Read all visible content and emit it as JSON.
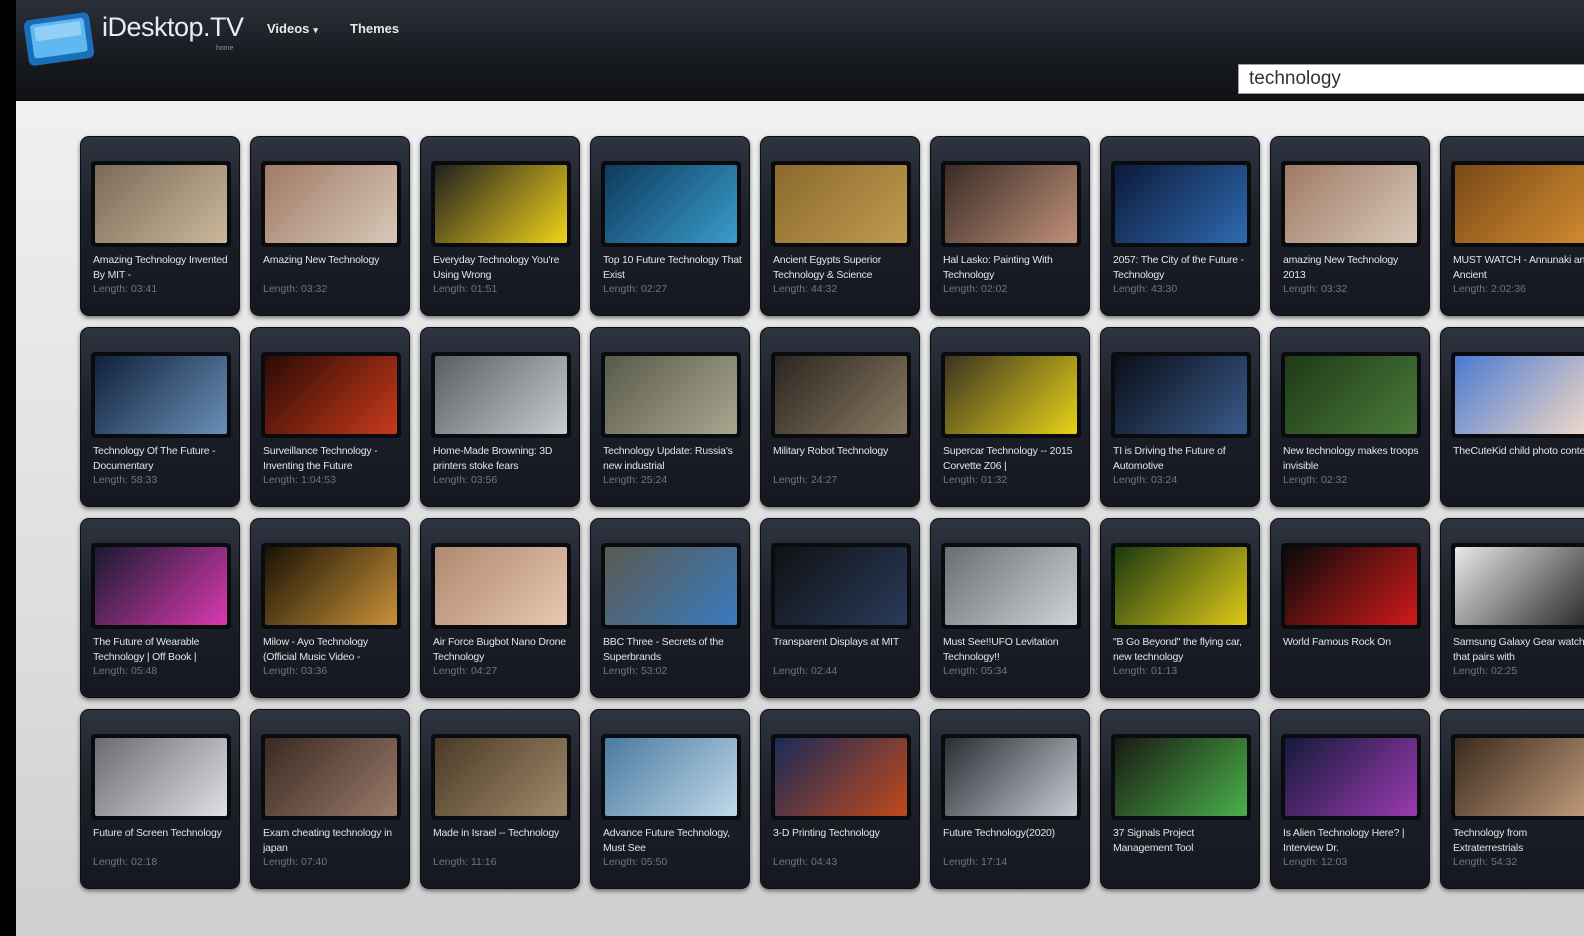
{
  "app": {
    "logo_text": "iDesktop.TV",
    "logo_subtext": "home",
    "nav": {
      "videos_label": "Videos",
      "themes_label": "Themes"
    },
    "search": {
      "value": "technology"
    }
  },
  "colors": {
    "topbar": "#181b21",
    "card": "#1b1f27",
    "accent": "#3aa0e8"
  },
  "videos": [
    {
      "title": "Amazing Technology Invented By MIT -",
      "length": "Length: 03:41",
      "thumb": [
        "#7a6a58",
        "#cbb89a"
      ]
    },
    {
      "title": "Amazing New Technology",
      "length": "Length: 03:32",
      "thumb": [
        "#a07a66",
        "#d8c8b8"
      ]
    },
    {
      "title": "Everyday Technology You're Using Wrong",
      "length": "Length: 01:51",
      "thumb": [
        "#202020",
        "#f2d21a"
      ]
    },
    {
      "title": "Top 10 Future Technology That Exist",
      "length": "Length: 02:27",
      "thumb": [
        "#0e3a5c",
        "#3a9ccc"
      ]
    },
    {
      "title": "Ancient Egypts Superior Technology & Science",
      "length": "Length: 44:32",
      "thumb": [
        "#8a6a2c",
        "#c09a50"
      ]
    },
    {
      "title": "Hal Lasko: Painting With Technology",
      "length": "Length: 02:02",
      "thumb": [
        "#3a2c26",
        "#c0907a"
      ]
    },
    {
      "title": "2057: The City of the Future - Technology",
      "length": "Length: 43:30",
      "thumb": [
        "#0c1a3a",
        "#2e6ab0"
      ]
    },
    {
      "title": "amazing New Technology 2013",
      "length": "Length: 03:32",
      "thumb": [
        "#a07a66",
        "#d8c8b8"
      ]
    },
    {
      "title": "MUST WATCH - Annunaki and Ancient",
      "length": "Length: 2:02:36",
      "thumb": [
        "#7a4a18",
        "#d08a30"
      ]
    },
    {
      "title": "Technology Of The Future - Documentary",
      "length": "Length: 58:33",
      "thumb": [
        "#10203a",
        "#6a90b8"
      ]
    },
    {
      "title": "Surveillance Technology - Inventing the Future",
      "length": "Length: 1:04:53",
      "thumb": [
        "#2a0a06",
        "#c83a1a"
      ]
    },
    {
      "title": "Home-Made Browning: 3D printers stoke fears",
      "length": "Length: 03:56",
      "thumb": [
        "#5a5e62",
        "#c8ccd0"
      ]
    },
    {
      "title": "Technology Update: Russia's new industrial",
      "length": "Length: 25:24",
      "thumb": [
        "#5a5a4a",
        "#a8a890"
      ]
    },
    {
      "title": "Military Robot Technology",
      "length": "Length: 24:27",
      "thumb": [
        "#2a2620",
        "#8a7a62"
      ]
    },
    {
      "title": "Supercar Technology -- 2015 Corvette Z06 |",
      "length": "Length: 01:32",
      "thumb": [
        "#3a3420",
        "#e8d218"
      ]
    },
    {
      "title": "TI is Driving the Future of Automotive",
      "length": "Length: 03:24",
      "thumb": [
        "#0a0e18",
        "#3a5a8a"
      ]
    },
    {
      "title": "New technology makes troops invisible",
      "length": "Length: 02:32",
      "thumb": [
        "#1e3a16",
        "#4a7a3a"
      ]
    },
    {
      "title": "TheCuteKid child photo contest",
      "length": "",
      "thumb": [
        "#4a7ad0",
        "#f0d8c8"
      ]
    },
    {
      "title": "The Future of Wearable Technology | Off Book |",
      "length": "Length: 05:48",
      "thumb": [
        "#1a1a30",
        "#d83ab0"
      ]
    },
    {
      "title": "Milow - Ayo Technology (Official Music Video -",
      "length": "Length: 03:36",
      "thumb": [
        "#1a1206",
        "#c89038"
      ]
    },
    {
      "title": "Air Force Bugbot Nano Drone Technology",
      "length": "Length: 04:27",
      "thumb": [
        "#b08870",
        "#e8c8b0"
      ]
    },
    {
      "title": "BBC Three - Secrets of the Superbrands",
      "length": "Length: 53:02",
      "thumb": [
        "#5a5a50",
        "#3a7ac0"
      ]
    },
    {
      "title": "Transparent Displays at MIT",
      "length": "Length: 02:44",
      "thumb": [
        "#101214",
        "#2a3a5a"
      ]
    },
    {
      "title": "Must See!!UFO Levitation Technology!!",
      "length": "Length: 05:34",
      "thumb": [
        "#6a6e72",
        "#d0d4d8"
      ]
    },
    {
      "title": "\"B Go Beyond\" the flying car, new technology",
      "length": "Length: 01:13",
      "thumb": [
        "#1a3a10",
        "#e0c818"
      ]
    },
    {
      "title": "World Famous Rock On",
      "length": "",
      "thumb": [
        "#0a0a0a",
        "#d01a1a"
      ]
    },
    {
      "title": "Samsung Galaxy Gear watch that pairs with",
      "length": "Length: 02:25",
      "thumb": [
        "#e8e8e8",
        "#2a2a2a"
      ]
    },
    {
      "title": "Future of Screen Technology",
      "length": "Length: 02:18",
      "thumb": [
        "#6a6a70",
        "#e0e0e4"
      ]
    },
    {
      "title": "Exam cheating technology in japan",
      "length": "Length: 07:40",
      "thumb": [
        "#3a2a22",
        "#9a7a6a"
      ]
    },
    {
      "title": "Made in Israel -- Technology",
      "length": "Length: 11:16",
      "thumb": [
        "#4a3a26",
        "#a08a6a"
      ]
    },
    {
      "title": "Advance Future Technology, Must See",
      "length": "Length: 05:50",
      "thumb": [
        "#4a7aa0",
        "#c0d8ea"
      ]
    },
    {
      "title": "3-D Printing Technology",
      "length": "Length: 04:43",
      "thumb": [
        "#1a2a5a",
        "#c04a1a"
      ]
    },
    {
      "title": "Future Technology(2020)",
      "length": "Length: 17:14",
      "thumb": [
        "#2a2e34",
        "#c8ccd2"
      ]
    },
    {
      "title": "37 Signals Project Management Tool",
      "length": "",
      "thumb": [
        "#1a1a14",
        "#4ab04a"
      ]
    },
    {
      "title": "Is Alien Technology Here? | Interview Dr.",
      "length": "Length: 12:03",
      "thumb": [
        "#141a3a",
        "#9a3ab0"
      ]
    },
    {
      "title": "Technology from Extraterrestrials",
      "length": "Length: 54:32",
      "thumb": [
        "#3a2a1e",
        "#c09a7a"
      ]
    }
  ]
}
